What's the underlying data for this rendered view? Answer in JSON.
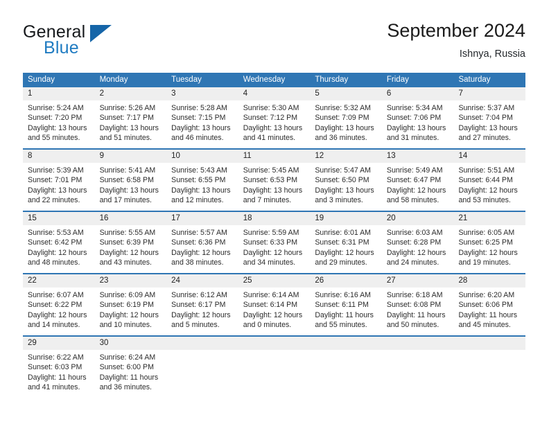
{
  "brand": {
    "name_part1": "General",
    "name_part2": "Blue",
    "triangle_color": "#1565a8",
    "blue_text_color": "#1f7bc1"
  },
  "header": {
    "title": "September 2024",
    "location": "Ishnya, Russia"
  },
  "theme": {
    "header_blue": "#2f76b4",
    "daynum_row_gray": "#efefef",
    "cell_white": "#ffffff"
  },
  "weekdays": [
    "Sunday",
    "Monday",
    "Tuesday",
    "Wednesday",
    "Thursday",
    "Friday",
    "Saturday"
  ],
  "weeks": [
    {
      "days": [
        {
          "num": "1",
          "sunrise": "Sunrise: 5:24 AM",
          "sunset": "Sunset: 7:20 PM",
          "daylight": "Daylight: 13 hours and 55 minutes."
        },
        {
          "num": "2",
          "sunrise": "Sunrise: 5:26 AM",
          "sunset": "Sunset: 7:17 PM",
          "daylight": "Daylight: 13 hours and 51 minutes."
        },
        {
          "num": "3",
          "sunrise": "Sunrise: 5:28 AM",
          "sunset": "Sunset: 7:15 PM",
          "daylight": "Daylight: 13 hours and 46 minutes."
        },
        {
          "num": "4",
          "sunrise": "Sunrise: 5:30 AM",
          "sunset": "Sunset: 7:12 PM",
          "daylight": "Daylight: 13 hours and 41 minutes."
        },
        {
          "num": "5",
          "sunrise": "Sunrise: 5:32 AM",
          "sunset": "Sunset: 7:09 PM",
          "daylight": "Daylight: 13 hours and 36 minutes."
        },
        {
          "num": "6",
          "sunrise": "Sunrise: 5:34 AM",
          "sunset": "Sunset: 7:06 PM",
          "daylight": "Daylight: 13 hours and 31 minutes."
        },
        {
          "num": "7",
          "sunrise": "Sunrise: 5:37 AM",
          "sunset": "Sunset: 7:04 PM",
          "daylight": "Daylight: 13 hours and 27 minutes."
        }
      ]
    },
    {
      "days": [
        {
          "num": "8",
          "sunrise": "Sunrise: 5:39 AM",
          "sunset": "Sunset: 7:01 PM",
          "daylight": "Daylight: 13 hours and 22 minutes."
        },
        {
          "num": "9",
          "sunrise": "Sunrise: 5:41 AM",
          "sunset": "Sunset: 6:58 PM",
          "daylight": "Daylight: 13 hours and 17 minutes."
        },
        {
          "num": "10",
          "sunrise": "Sunrise: 5:43 AM",
          "sunset": "Sunset: 6:55 PM",
          "daylight": "Daylight: 13 hours and 12 minutes."
        },
        {
          "num": "11",
          "sunrise": "Sunrise: 5:45 AM",
          "sunset": "Sunset: 6:53 PM",
          "daylight": "Daylight: 13 hours and 7 minutes."
        },
        {
          "num": "12",
          "sunrise": "Sunrise: 5:47 AM",
          "sunset": "Sunset: 6:50 PM",
          "daylight": "Daylight: 13 hours and 3 minutes."
        },
        {
          "num": "13",
          "sunrise": "Sunrise: 5:49 AM",
          "sunset": "Sunset: 6:47 PM",
          "daylight": "Daylight: 12 hours and 58 minutes."
        },
        {
          "num": "14",
          "sunrise": "Sunrise: 5:51 AM",
          "sunset": "Sunset: 6:44 PM",
          "daylight": "Daylight: 12 hours and 53 minutes."
        }
      ]
    },
    {
      "days": [
        {
          "num": "15",
          "sunrise": "Sunrise: 5:53 AM",
          "sunset": "Sunset: 6:42 PM",
          "daylight": "Daylight: 12 hours and 48 minutes."
        },
        {
          "num": "16",
          "sunrise": "Sunrise: 5:55 AM",
          "sunset": "Sunset: 6:39 PM",
          "daylight": "Daylight: 12 hours and 43 minutes."
        },
        {
          "num": "17",
          "sunrise": "Sunrise: 5:57 AM",
          "sunset": "Sunset: 6:36 PM",
          "daylight": "Daylight: 12 hours and 38 minutes."
        },
        {
          "num": "18",
          "sunrise": "Sunrise: 5:59 AM",
          "sunset": "Sunset: 6:33 PM",
          "daylight": "Daylight: 12 hours and 34 minutes."
        },
        {
          "num": "19",
          "sunrise": "Sunrise: 6:01 AM",
          "sunset": "Sunset: 6:31 PM",
          "daylight": "Daylight: 12 hours and 29 minutes."
        },
        {
          "num": "20",
          "sunrise": "Sunrise: 6:03 AM",
          "sunset": "Sunset: 6:28 PM",
          "daylight": "Daylight: 12 hours and 24 minutes."
        },
        {
          "num": "21",
          "sunrise": "Sunrise: 6:05 AM",
          "sunset": "Sunset: 6:25 PM",
          "daylight": "Daylight: 12 hours and 19 minutes."
        }
      ]
    },
    {
      "days": [
        {
          "num": "22",
          "sunrise": "Sunrise: 6:07 AM",
          "sunset": "Sunset: 6:22 PM",
          "daylight": "Daylight: 12 hours and 14 minutes."
        },
        {
          "num": "23",
          "sunrise": "Sunrise: 6:09 AM",
          "sunset": "Sunset: 6:19 PM",
          "daylight": "Daylight: 12 hours and 10 minutes."
        },
        {
          "num": "24",
          "sunrise": "Sunrise: 6:12 AM",
          "sunset": "Sunset: 6:17 PM",
          "daylight": "Daylight: 12 hours and 5 minutes."
        },
        {
          "num": "25",
          "sunrise": "Sunrise: 6:14 AM",
          "sunset": "Sunset: 6:14 PM",
          "daylight": "Daylight: 12 hours and 0 minutes."
        },
        {
          "num": "26",
          "sunrise": "Sunrise: 6:16 AM",
          "sunset": "Sunset: 6:11 PM",
          "daylight": "Daylight: 11 hours and 55 minutes."
        },
        {
          "num": "27",
          "sunrise": "Sunrise: 6:18 AM",
          "sunset": "Sunset: 6:08 PM",
          "daylight": "Daylight: 11 hours and 50 minutes."
        },
        {
          "num": "28",
          "sunrise": "Sunrise: 6:20 AM",
          "sunset": "Sunset: 6:06 PM",
          "daylight": "Daylight: 11 hours and 45 minutes."
        }
      ]
    },
    {
      "days": [
        {
          "num": "29",
          "sunrise": "Sunrise: 6:22 AM",
          "sunset": "Sunset: 6:03 PM",
          "daylight": "Daylight: 11 hours and 41 minutes."
        },
        {
          "num": "30",
          "sunrise": "Sunrise: 6:24 AM",
          "sunset": "Sunset: 6:00 PM",
          "daylight": "Daylight: 11 hours and 36 minutes."
        },
        {
          "num": "",
          "sunrise": "",
          "sunset": "",
          "daylight": ""
        },
        {
          "num": "",
          "sunrise": "",
          "sunset": "",
          "daylight": ""
        },
        {
          "num": "",
          "sunrise": "",
          "sunset": "",
          "daylight": ""
        },
        {
          "num": "",
          "sunrise": "",
          "sunset": "",
          "daylight": ""
        },
        {
          "num": "",
          "sunrise": "",
          "sunset": "",
          "daylight": ""
        }
      ]
    }
  ]
}
